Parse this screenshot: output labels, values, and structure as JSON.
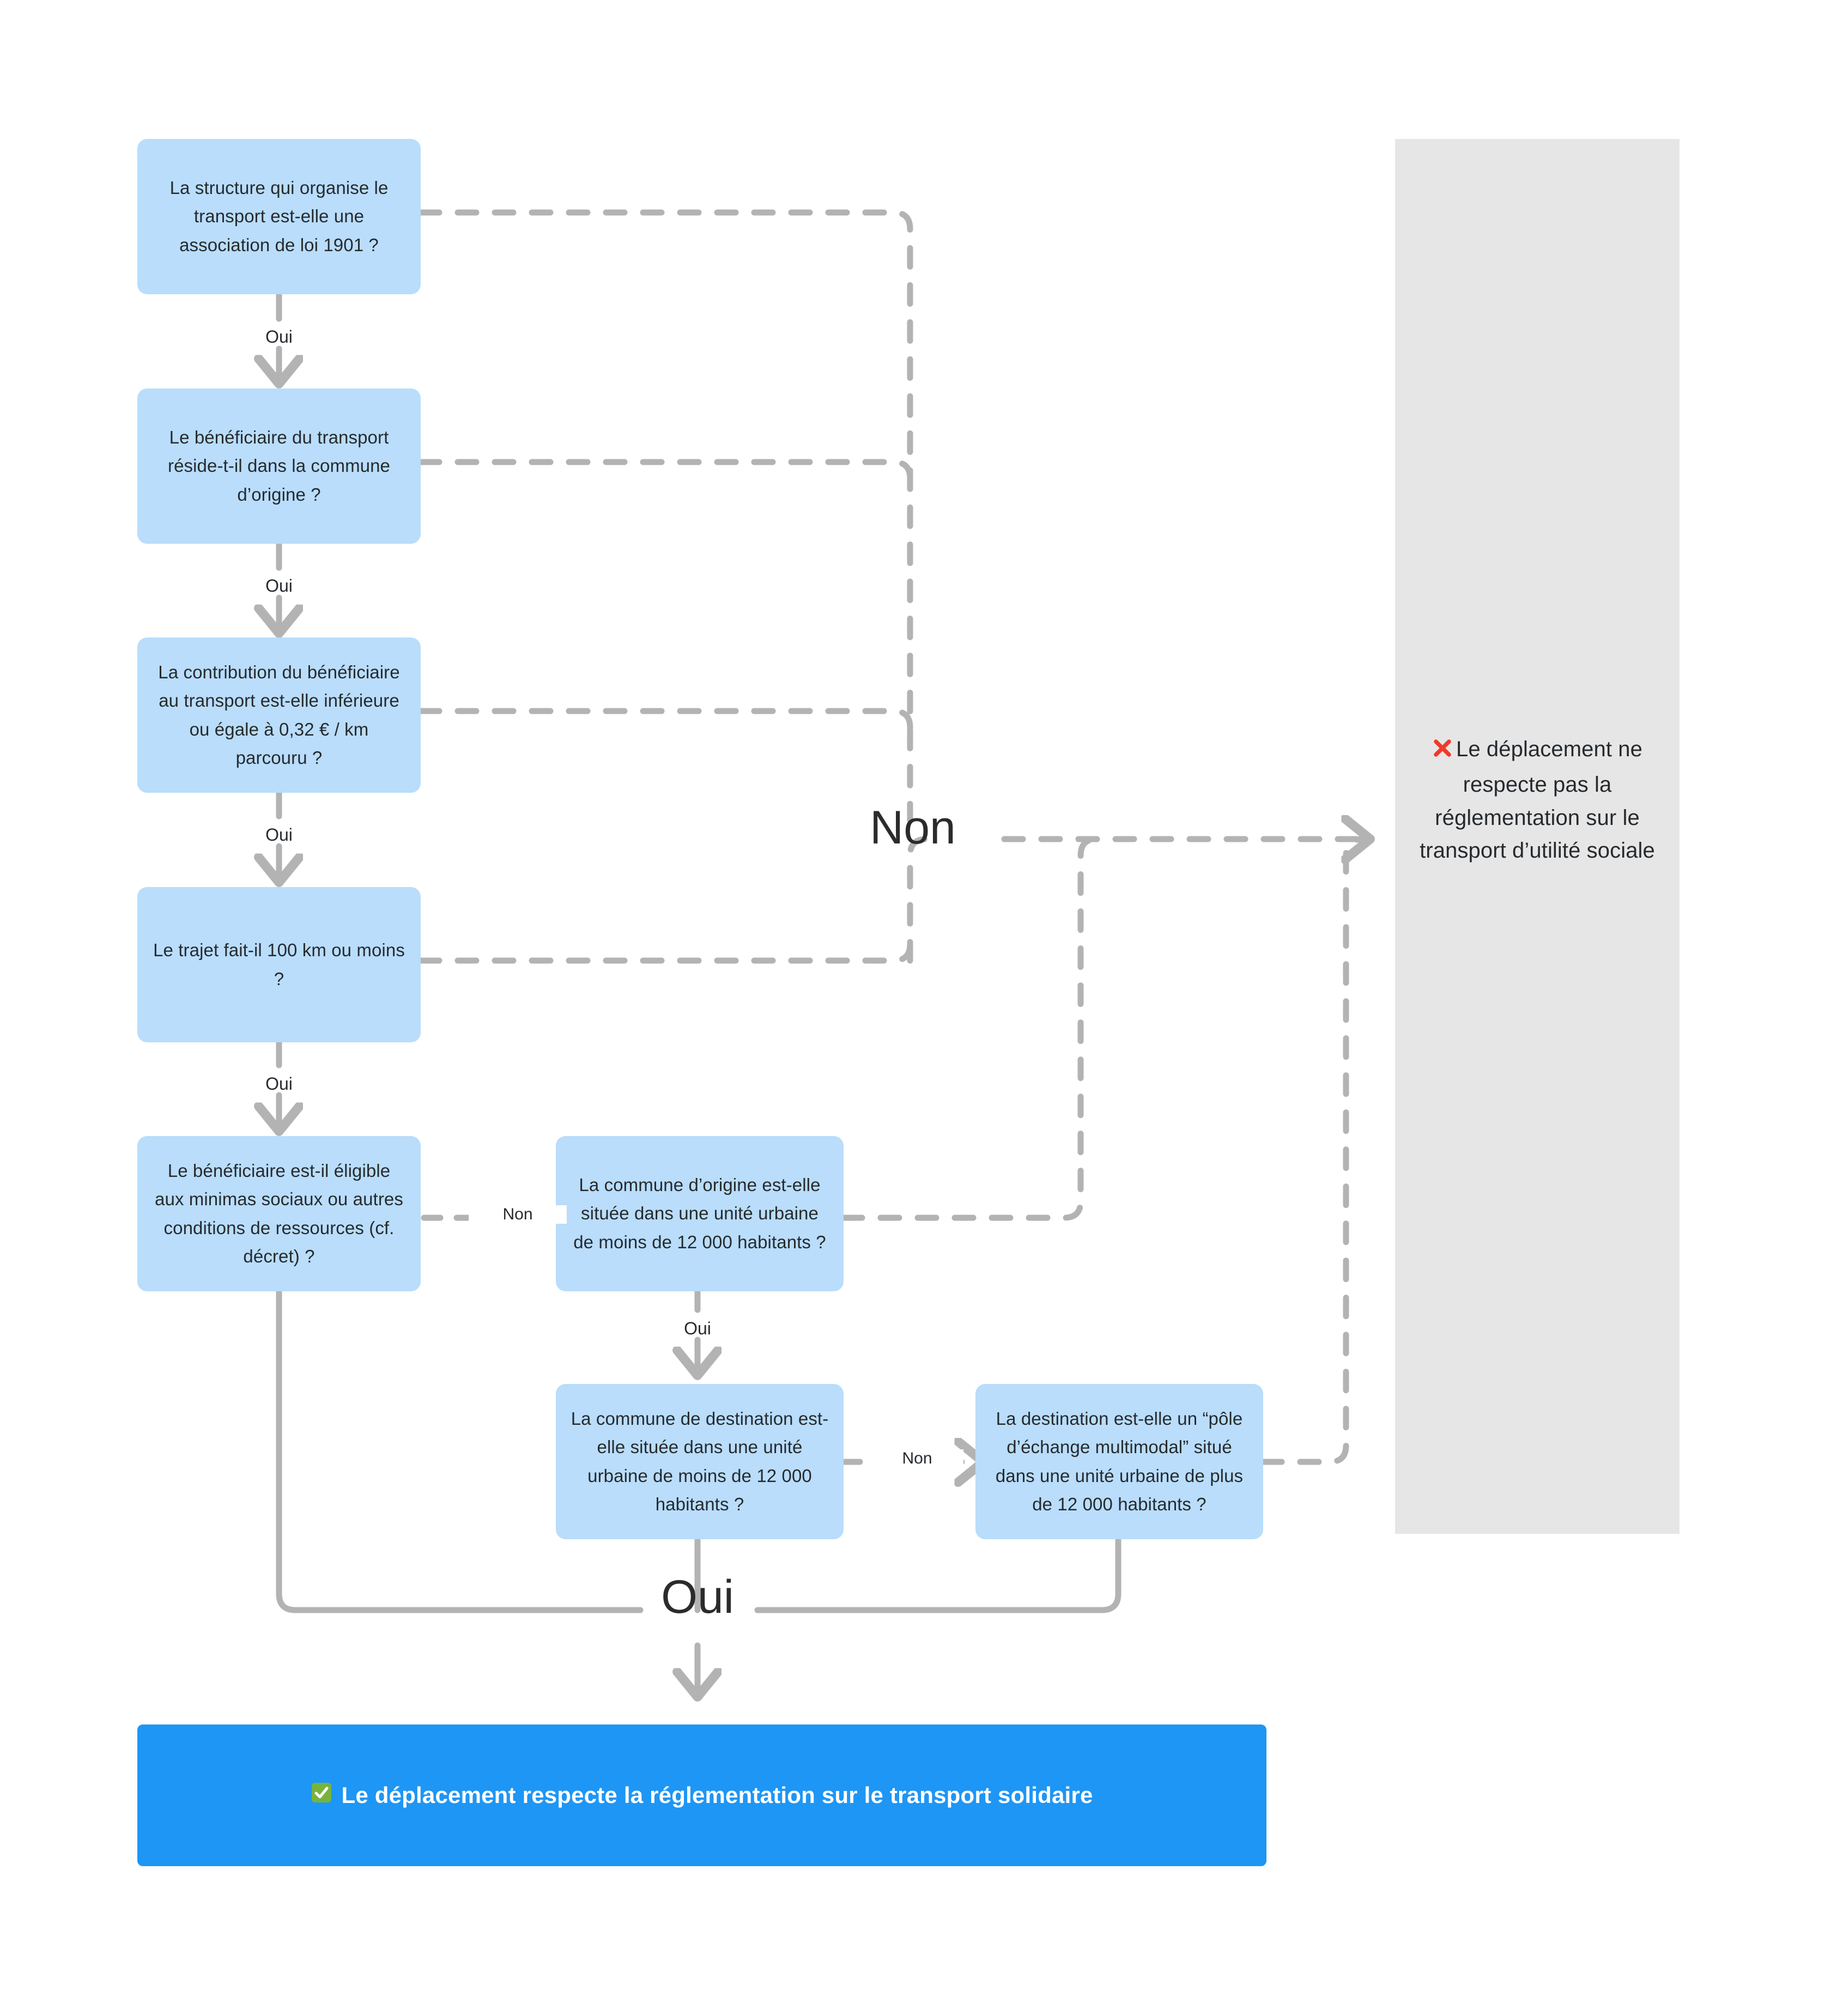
{
  "diagram": {
    "title_visible": false,
    "colors": {
      "node_fill": "#b9ddfb",
      "node_text": "#262a2e",
      "panel_fail_fill": "#e6e6e6",
      "bar_success_fill": "#1e96f5",
      "bar_success_text": "#ffffff",
      "connector": "#b3b3b3",
      "background": "#ffffff"
    },
    "nodes": [
      {
        "id": "q1",
        "text": "La structure qui organise le transport est-elle une association de loi 1901 ?"
      },
      {
        "id": "q2",
        "text": "Le bénéficiaire du transport réside-t-il dans la commune d’origine ?"
      },
      {
        "id": "q3",
        "text": "La contribution du bénéficiaire au transport est-elle inférieure ou égale à 0,32 € / km parcouru ?"
      },
      {
        "id": "q4",
        "text": "Le trajet fait-il 100 km ou moins ?"
      },
      {
        "id": "q5",
        "text": "Le bénéficiaire est-il éligible aux minimas sociaux ou autres conditions de ressources  (cf. décret) ?"
      },
      {
        "id": "q6",
        "text": "La commune d’origine est-elle située dans une unité urbaine de moins de 12 000 habitants ?"
      },
      {
        "id": "q7",
        "text": "La commune de destination est-elle située dans une unité urbaine de moins de 12 000 habitants ?"
      },
      {
        "id": "q8",
        "text": "La destination est-elle un “pôle d’échange multimodal” situé dans une unité urbaine de plus de 12 000 habitants ?"
      }
    ],
    "outcome_fail": {
      "icon": "cross-mark-emoji",
      "text": "Le déplacement ne respecte pas la réglementation sur le transport d’utilité sociale"
    },
    "outcome_success": {
      "icon": "check-mark-button-emoji",
      "text": "Le déplacement respecte la réglementation sur le transport solidaire"
    },
    "edge_labels": {
      "oui_1": "Oui",
      "oui_2": "Oui",
      "oui_3": "Oui",
      "oui_4": "Oui",
      "oui_5": "Oui",
      "non_big": "Non",
      "non_q5": "Non",
      "non_q7": "Non",
      "oui_big": "Oui"
    }
  }
}
